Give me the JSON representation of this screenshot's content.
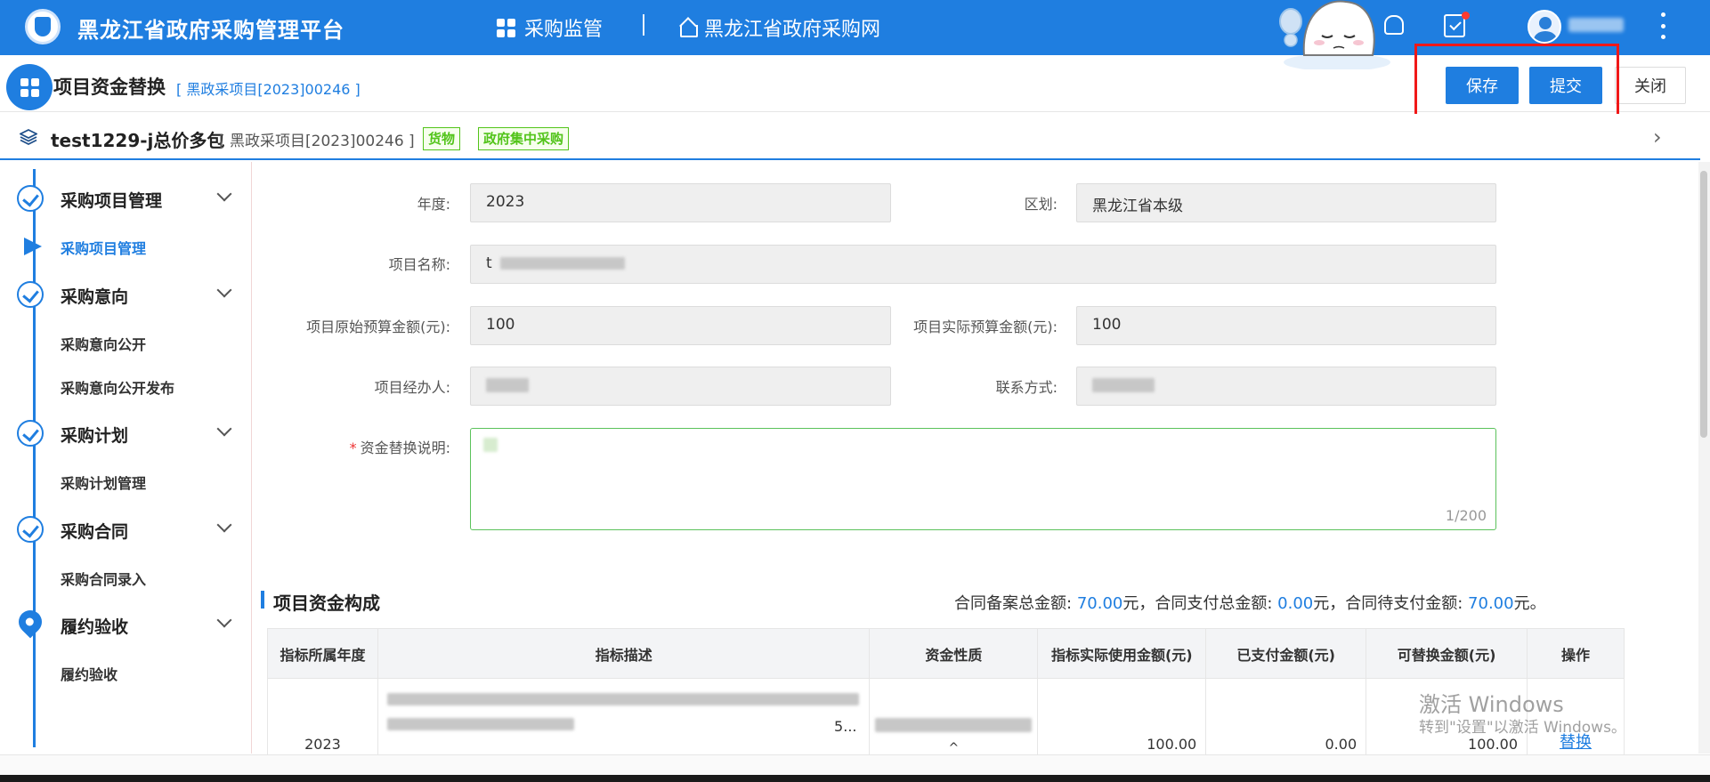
{
  "topbar": {
    "app_title": "黑龙江省政府采购管理平台",
    "nav": [
      {
        "label": "采购监管",
        "icon": "grid-icon"
      },
      {
        "label": "黑龙江省政府采购网",
        "icon": "home-icon"
      }
    ],
    "accent": "#1f7ee0"
  },
  "header": {
    "title": "项目资金替换",
    "code": "[ 黑政采项目[2023]00246 ]",
    "buttons": {
      "save": "保存",
      "submit": "提交",
      "close": "关闭"
    }
  },
  "project": {
    "name": "test1229-j总价多包",
    "code": "[ 黑政采项目[2023]00246 ]",
    "tags": [
      "货物",
      "政府集中采购"
    ]
  },
  "sidebar": {
    "sections": [
      {
        "label": "采购项目管理",
        "items": [
          "采购项目管理"
        ]
      },
      {
        "label": "采购意向",
        "items": [
          "采购意向公开",
          "采购意向公开发布"
        ]
      },
      {
        "label": "采购计划",
        "items": [
          "采购计划管理"
        ]
      },
      {
        "label": "采购合同",
        "items": [
          "采购合同录入"
        ]
      },
      {
        "label": "履约验收",
        "items": [
          "履约验收"
        ]
      }
    ]
  },
  "form": {
    "year_label": "年度:",
    "year_value": "2023",
    "region_label": "区划:",
    "region_value": "黑龙江省本级",
    "name_label": "项目名称:",
    "name_value": "t",
    "orig_budget_label": "项目原始预算金额(元):",
    "orig_budget_value": "100",
    "actual_budget_label": "项目实际预算金额(元):",
    "actual_budget_value": "100",
    "manager_label": "项目经办人:",
    "contact_label": "联系方式:",
    "desc_label": "资金替换说明:",
    "desc_required": "*",
    "desc_count": "1/200"
  },
  "fund": {
    "title": "项目资金构成",
    "summary": {
      "contract_total_label": "合同备案总金额:",
      "contract_total": "70.00",
      "paid_total_label": "元，合同支付总金额:",
      "paid_total": "0.00",
      "pending_label": "元，合同待支付金额:",
      "pending": "70.00",
      "suffix": "元。"
    },
    "table": {
      "headers": [
        "指标所属年度",
        "指标描述",
        "资金性质",
        "指标实际使用金额(元)",
        "已支付金额(元)",
        "可替换金额(元)",
        "操作"
      ],
      "rows": [
        {
          "year": "2023",
          "desc_tail": "5...",
          "nature_caret": "^",
          "used": "100.00",
          "paid": "0.00",
          "replaceable": "100.00",
          "action": "替换"
        }
      ]
    }
  },
  "watermark": {
    "line1": "激活 Windows",
    "line2": "转到\"设置\"以激活 Windows。"
  }
}
